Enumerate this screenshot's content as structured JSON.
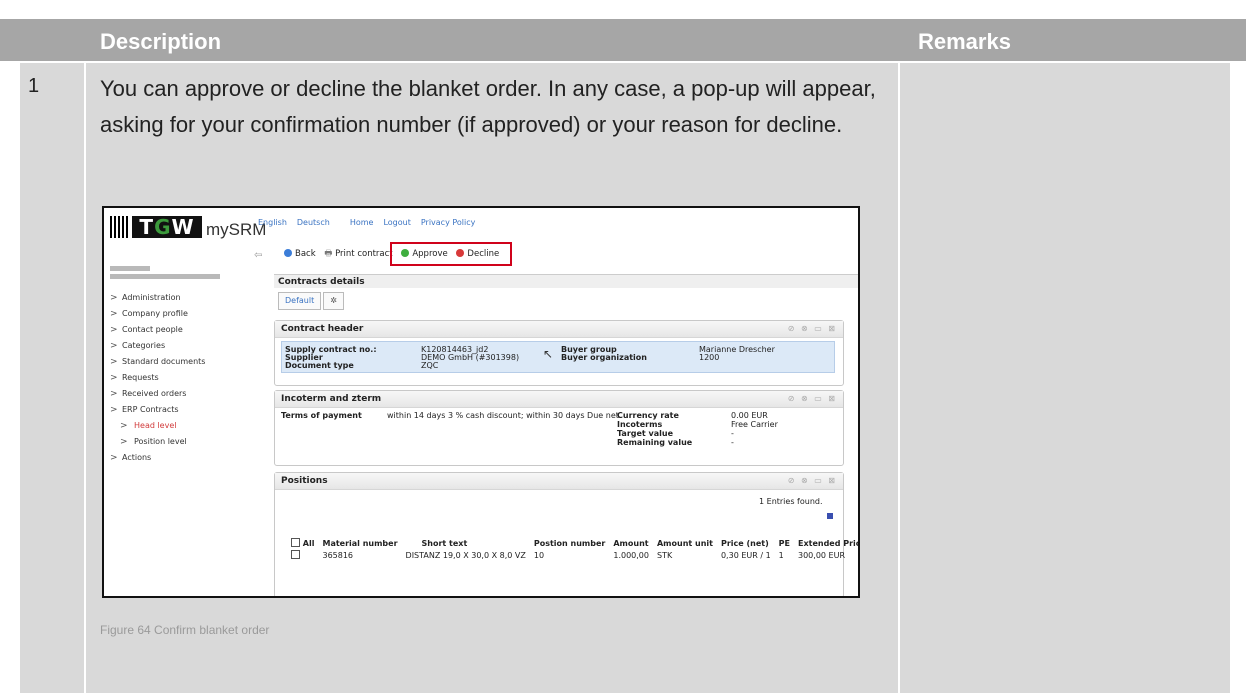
{
  "table": {
    "header_desc": "Description",
    "header_remarks": "Remarks",
    "row_number": "1",
    "description": "You can approve or decline the blanket order. In any case, a pop-up will appear, asking for your confirmation number (if approved) or your reason for decline.",
    "caption": "Figure 64 Confirm blanket order"
  },
  "app": {
    "logo_text_1": "T",
    "logo_text_2": "G",
    "logo_text_3": "W",
    "brand": "mySRM",
    "links": [
      "English",
      "Deutsch",
      "Home",
      "Logout",
      "Privacy Policy"
    ],
    "collapse_icon": "double-arrow-icon"
  },
  "toolbar": {
    "back": "Back",
    "print": "Print contract",
    "approve": "Approve",
    "decline": "Decline"
  },
  "nav": [
    {
      "label": "Administration",
      "level": 0
    },
    {
      "label": "Company profile",
      "level": 0
    },
    {
      "label": "Contact people",
      "level": 0
    },
    {
      "label": "Categories",
      "level": 0
    },
    {
      "label": "Standard documents",
      "level": 0
    },
    {
      "label": "Requests",
      "level": 0
    },
    {
      "label": "Received orders",
      "level": 0
    },
    {
      "label": "ERP Contracts",
      "level": 0
    },
    {
      "label": "Head level",
      "level": 1,
      "active": true
    },
    {
      "label": "Position level",
      "level": 1
    },
    {
      "label": "Actions",
      "level": 0
    }
  ],
  "contracts": {
    "title": "Contracts details",
    "tab_default": "Default",
    "tab_gear": "✲"
  },
  "header_panel": {
    "title": "Contract header",
    "supply_label": "Supply contract no.:",
    "supply_value": "K120814463_jd2",
    "supplier_label": "Supplier",
    "supplier_value": "DEMO GmbH (#301398)",
    "doctype_label": "Document type",
    "doctype_value": "ZQC",
    "buyer_group_label": "Buyer group",
    "buyer_group_value": "Marianne Drescher",
    "buyer_org_label": "Buyer organization",
    "buyer_org_value": "1200"
  },
  "incoterm_panel": {
    "title": "Incoterm and zterm",
    "terms_label": "Terms of payment",
    "terms_value": "within 14 days 3 % cash discount; within 30 days Due net",
    "currency_label": "Currency rate",
    "currency_value": "0.00 EUR",
    "incoterms_label": "Incoterms",
    "incoterms_value": "Free Carrier",
    "target_label": "Target value",
    "target_value": "-",
    "remaining_label": "Remaining value",
    "remaining_value": "-"
  },
  "positions_panel": {
    "title": "Positions",
    "entries": "1 Entries found.",
    "columns": [
      "All",
      "Material number",
      "Short text",
      "Postion number",
      "Amount",
      "Amount unit",
      "Price (net)",
      "PE",
      "Extended Price"
    ],
    "rows": [
      [
        "",
        "365816",
        "DISTANZ 19,0 X 30,0 X 8,0 VZ",
        "10",
        "1.000,00",
        "STK",
        "0,30 EUR / 1",
        "1",
        "300,00 EUR"
      ]
    ]
  },
  "panel_controls": "⊘ ⊗ ▭ ⊠"
}
